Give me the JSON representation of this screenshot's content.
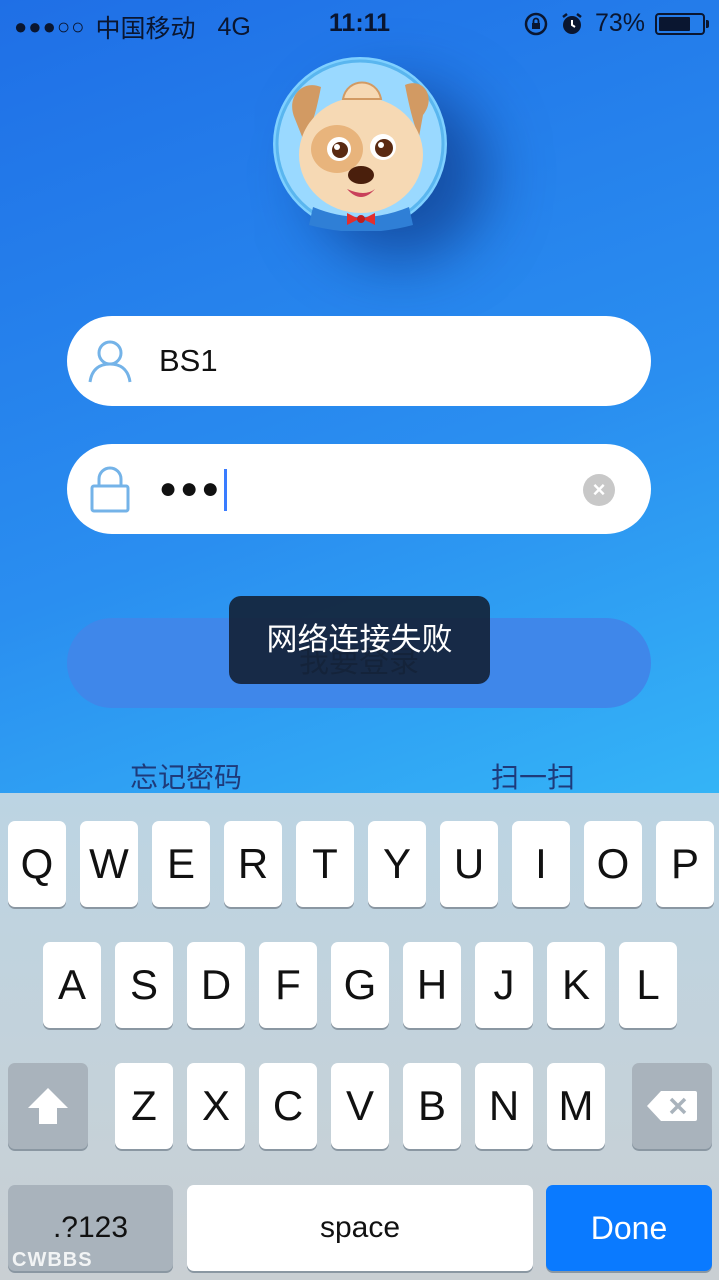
{
  "status_bar": {
    "signal": "●●●○○",
    "carrier": "中国移动",
    "network": "4G",
    "time": "11:11",
    "battery_percent": "73%",
    "battery_level": 0.73
  },
  "avatar": {
    "icon": "cartoon-dog-avatar"
  },
  "login_form": {
    "username_value": "BS1",
    "username_icon": "user-icon",
    "password_value": "●●●",
    "password_icon": "lock-icon",
    "clear_icon": "clear-icon"
  },
  "login_button": {
    "label": "我要登录"
  },
  "toast": {
    "message": "网络连接失败"
  },
  "links": {
    "forgot_password": "忘记密码",
    "scan": "扫一扫"
  },
  "keyboard": {
    "row1": [
      "Q",
      "W",
      "E",
      "R",
      "T",
      "Y",
      "U",
      "I",
      "O",
      "P"
    ],
    "row2": [
      "A",
      "S",
      "D",
      "F",
      "G",
      "H",
      "J",
      "K",
      "L"
    ],
    "row3": [
      "Z",
      "X",
      "C",
      "V",
      "B",
      "N",
      "M"
    ],
    "numbers_label": ".?123",
    "space_label": "space",
    "done_label": "Done"
  },
  "watermark": "CWBBS",
  "colors": {
    "accent": "#0a7aff",
    "background_top": "#1f6fe6",
    "background_bottom": "#36c4f8"
  }
}
